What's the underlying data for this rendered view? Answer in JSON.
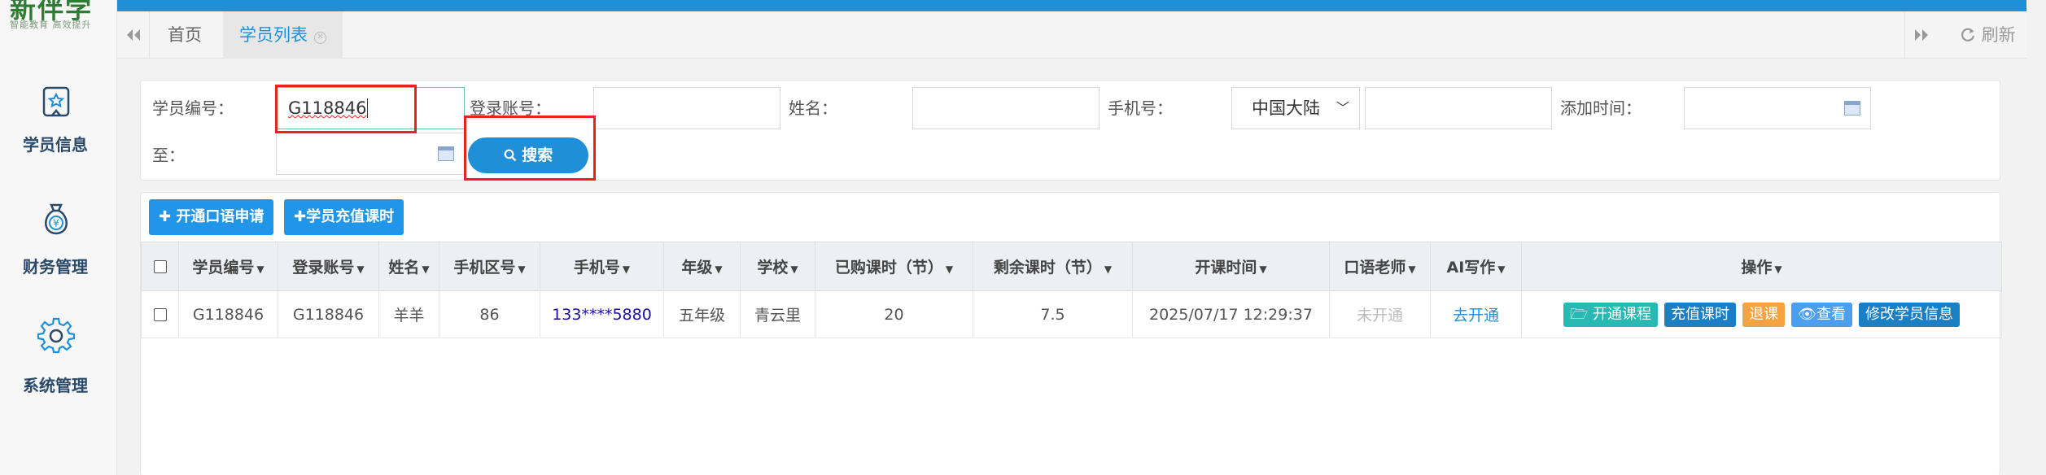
{
  "app": {
    "logo_text": "新伴学",
    "logo_slogan": "智能教育 高效提升"
  },
  "sidebar": {
    "items": [
      {
        "label": "学员信息",
        "icon": "student-badge-icon"
      },
      {
        "label": "财务管理",
        "icon": "money-bag-icon"
      },
      {
        "label": "系统管理",
        "icon": "gear-icon"
      }
    ]
  },
  "tabs": {
    "items": [
      {
        "label": "首页",
        "active": false
      },
      {
        "label": "学员列表",
        "active": true,
        "closable": true
      }
    ],
    "refresh_label": "刷新"
  },
  "search": {
    "student_id_label": "学员编号：",
    "student_id_value": "G118846",
    "login_label": "登录账号：",
    "login_value": "",
    "name_label": "姓名：",
    "name_value": "",
    "phone_label": "手机号：",
    "region_value": "中国大陆",
    "phone_value": "",
    "add_time_label": "添加时间：",
    "add_time_value": "",
    "to_label": "至：",
    "to_value": "",
    "search_button": "搜索"
  },
  "toolbar": {
    "open_oral_label": "开通口语申请",
    "recharge_label": "学员充值课时"
  },
  "table": {
    "columns": [
      "学员编号",
      "登录账号",
      "姓名",
      "手机区号",
      "手机号",
      "年级",
      "学校",
      "已购课时（节）",
      "剩余课时（节）",
      "开课时间",
      "口语老师",
      "AI写作",
      "操作"
    ],
    "rows": [
      {
        "student_id": "G118846",
        "login": "G118846",
        "name": "羊羊",
        "area_code": "86",
        "phone": "133****5880",
        "grade": "五年级",
        "school": "青云里",
        "bought": "20",
        "remaining": "7.5",
        "start_time": "2025/07/17 12:29:37",
        "oral_teacher": "未开通",
        "ai_writing": "去开通",
        "actions": [
          "开通课程",
          "充值课时",
          "退课",
          "查看",
          "修改学员信息"
        ]
      }
    ]
  },
  "colors": {
    "primary": "#1f8fd8",
    "teal": "#29b9b3",
    "orange": "#f4a340",
    "highlight_red": "#e8221f"
  }
}
